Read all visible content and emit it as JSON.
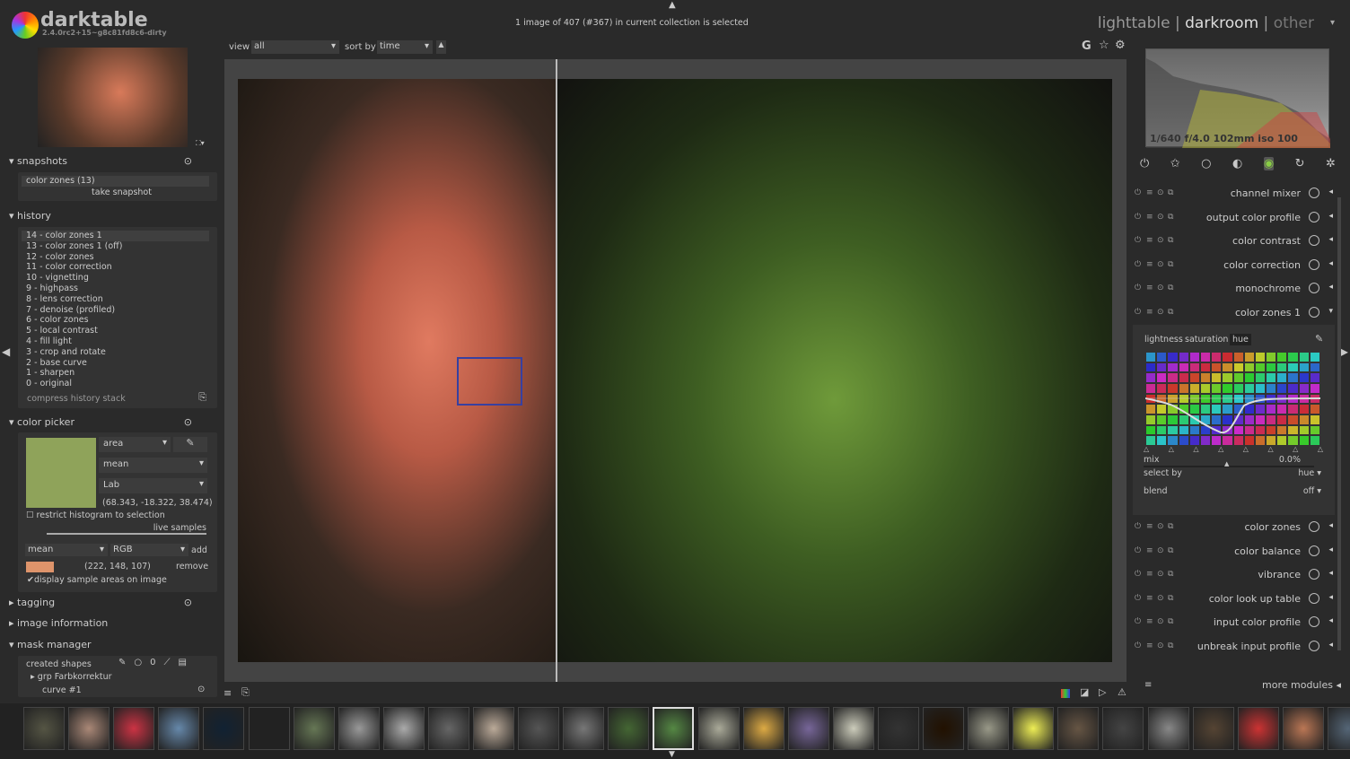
{
  "app": {
    "name": "darktable",
    "version": "2.4.0rc2+15~g8c81fd8c6-dirty"
  },
  "header": {
    "status": "1 image of 407 (#367) in current collection is selected",
    "views": [
      "lighttable",
      "darkroom",
      "other"
    ],
    "active_view": "darkroom"
  },
  "toolbar": {
    "view_label": "view",
    "view_value": "all",
    "sort_label": "sort by",
    "sort_value": "time"
  },
  "snapshots": {
    "title": "snapshots",
    "items": [
      "color zones (13)"
    ],
    "take": "take snapshot"
  },
  "history": {
    "title": "history",
    "items": [
      "14 - color zones 1",
      "13 - color zones 1 (off)",
      "12 - color zones",
      "11 - color correction",
      "10 - vignetting",
      "9 - highpass",
      "8 - lens correction",
      "7 - denoise (profiled)",
      "6 - color zones",
      "5 - local contrast",
      "4 - fill light",
      "3 - crop and rotate",
      "2 - base curve",
      "1 - sharpen",
      "0 - original"
    ],
    "compress": "compress history stack"
  },
  "color_picker": {
    "title": "color picker",
    "swatch": "#8fa35a",
    "mode": "area",
    "stat": "mean",
    "space": "Lab",
    "value": "(68.343, -18.322, 38.474)",
    "restrict": "restrict histogram to selection",
    "live": "live samples",
    "sample_stat": "mean",
    "sample_space": "RGB",
    "add": "add",
    "sample_swatch": "#de946b",
    "sample_value": "(222, 148, 107)",
    "remove": "remove",
    "display": "display sample areas on image"
  },
  "tagging": {
    "title": "tagging"
  },
  "image_info": {
    "title": "image information"
  },
  "mask_manager": {
    "title": "mask manager",
    "created": "created shapes",
    "items": [
      "grp Farbkorrektur",
      "curve #1"
    ]
  },
  "histogram": {
    "exif": "1/640 f/4.0 102mm iso 100"
  },
  "modules": [
    {
      "name": "channel mixer"
    },
    {
      "name": "output color profile"
    },
    {
      "name": "color contrast"
    },
    {
      "name": "color correction"
    },
    {
      "name": "monochrome"
    },
    {
      "name": "color zones 1",
      "expanded": true
    }
  ],
  "color_zones": {
    "tabs": [
      "lightness",
      "saturation",
      "hue"
    ],
    "active_tab": "hue",
    "mix_label": "mix",
    "mix_value": "0.0%",
    "select_label": "select by",
    "select_value": "hue",
    "blend_label": "blend",
    "blend_value": "off"
  },
  "modules2": [
    {
      "name": "color zones"
    },
    {
      "name": "color balance"
    },
    {
      "name": "vibrance"
    },
    {
      "name": "color look up table"
    },
    {
      "name": "input color profile"
    },
    {
      "name": "unbreak input profile"
    }
  ],
  "more_modules": "more modules"
}
